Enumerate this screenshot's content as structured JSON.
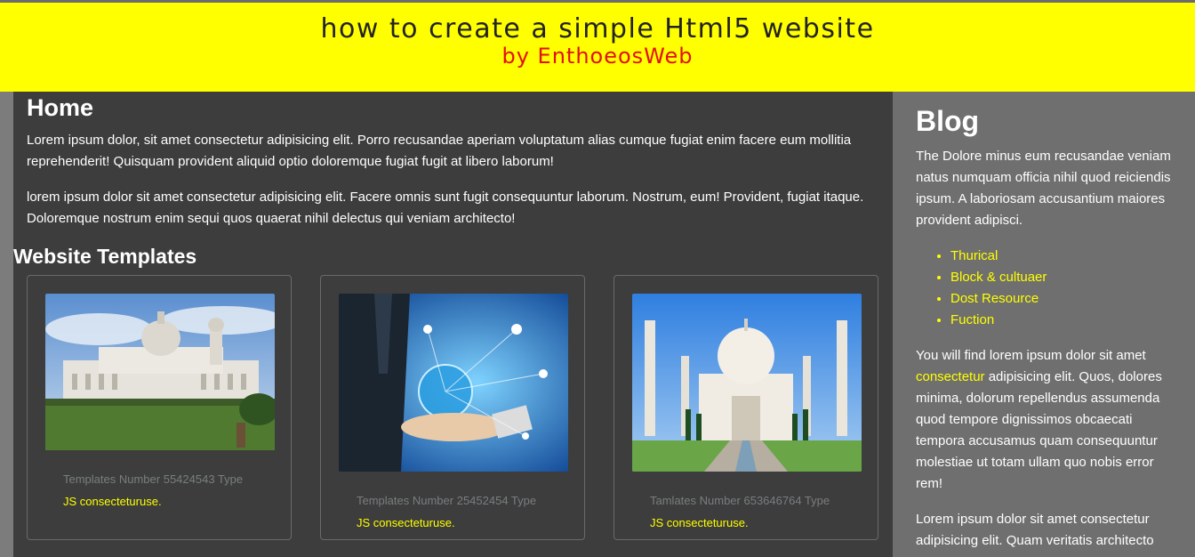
{
  "header": {
    "title": "how to create a simple Html5 website",
    "subtitle": "by EnthoeosWeb"
  },
  "main": {
    "heading": "Home",
    "paragraphs": [
      "Lorem ipsum dolor, sit amet consectetur adipisicing elit. Porro recusandae aperiam voluptatum alias cumque fugiat enim facere eum mollitia reprehenderit! Quisquam provident aliquid optio doloremque fugiat fugit at libero laborum!",
      "lorem ipsum dolor sit amet consectetur adipisicing elit. Facere omnis sunt fugit consequuntur laborum. Nostrum, eum! Provident, fugiat itaque. Doloremque nostrum enim sequi quos quaerat nihil delectus qui veniam architecto!"
    ],
    "templates_heading": "Website Templates",
    "cards": [
      {
        "image": "palace-photo",
        "meta": "Templates Number 55424543 Type",
        "link": "JS consecteturuse."
      },
      {
        "image": "business-tech-photo",
        "meta": "Templates Number 25452454 Type",
        "link": "JS consecteturuse."
      },
      {
        "image": "taj-mahal-photo",
        "meta": "Tamlates Number 653646764 Type",
        "link": "JS consecteturuse."
      }
    ]
  },
  "sidebar": {
    "heading": "Blog",
    "intro": "The Dolore minus eum recusandae veniam natus numquam officia nihil quod reiciendis ipsum. A laboriosam accusantium maiores provident adipisci.",
    "links": [
      "Thurical",
      "Block & cultuaer",
      "Dost Resource",
      "Fuction"
    ],
    "para2_start": "You will find lorem ipsum dolor sit amet ",
    "para2_link": "consectetur",
    "para2_end": " adipisicing elit. Quos, dolores minima, dolorum repellendus assumenda quod tempore dignissimos obcaecati tempora accusamus quam consequuntur molestiae ut totam ullam quo nobis error rem!",
    "para3": "Lorem ipsum dolor sit amet consectetur adipisicing elit. Quam veritatis architecto"
  },
  "colors": {
    "header_bg": "#ffff00",
    "subtitle": "#e21010",
    "main_bg": "#3c3d3c",
    "sidebar_bg": "#6f6f70",
    "link": "#ffff00"
  }
}
